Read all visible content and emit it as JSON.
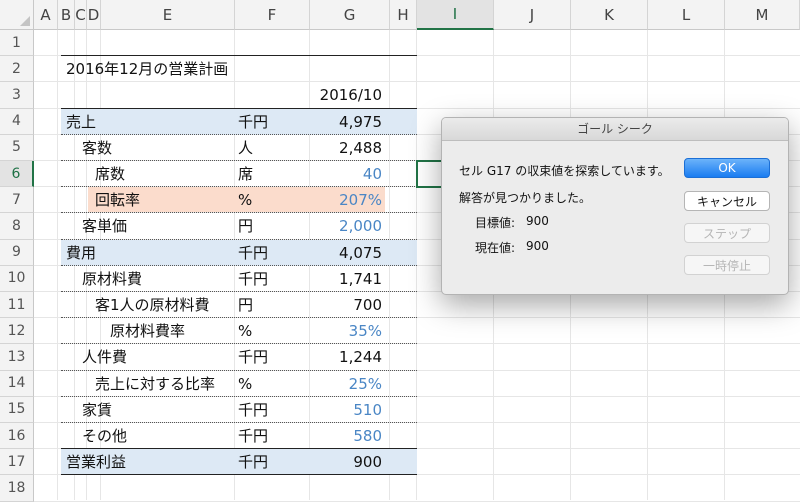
{
  "columns": [
    "A",
    "B",
    "C",
    "D",
    "E",
    "F",
    "G",
    "H",
    "I",
    "J",
    "K",
    "L",
    "M"
  ],
  "selected_column": "I",
  "rows": [
    "1",
    "2",
    "3",
    "4",
    "5",
    "6",
    "7",
    "8",
    "9",
    "10",
    "11",
    "12",
    "13",
    "14",
    "15",
    "16",
    "17",
    "18"
  ],
  "selected_row": "6",
  "sheet": {
    "title": "2016年12月の営業計画",
    "period": "2016/10",
    "lines": [
      {
        "row": 4,
        "label": "売上",
        "unit": "千円",
        "value": "4,975",
        "input": false
      },
      {
        "row": 5,
        "label": "客数",
        "unit": "人",
        "value": "2,488",
        "input": false
      },
      {
        "row": 6,
        "label": "席数",
        "unit": "席",
        "value": "40",
        "input": true
      },
      {
        "row": 7,
        "label": "回転率",
        "unit": "%",
        "value": "207%",
        "input": true
      },
      {
        "row": 8,
        "label": "客単価",
        "unit": "円",
        "value": "2,000",
        "input": true
      },
      {
        "row": 9,
        "label": "費用",
        "unit": "千円",
        "value": "4,075",
        "input": false
      },
      {
        "row": 10,
        "label": "原材料費",
        "unit": "千円",
        "value": "1,741",
        "input": false
      },
      {
        "row": 11,
        "label": "客1人の原材料費",
        "unit": "円",
        "value": "700",
        "input": false
      },
      {
        "row": 12,
        "label": "原材料費率",
        "unit": "%",
        "value": "35%",
        "input": true
      },
      {
        "row": 13,
        "label": "人件費",
        "unit": "千円",
        "value": "1,244",
        "input": false
      },
      {
        "row": 14,
        "label": "売上に対する比率",
        "unit": "%",
        "value": "25%",
        "input": true
      },
      {
        "row": 15,
        "label": "家賃",
        "unit": "千円",
        "value": "510",
        "input": true
      },
      {
        "row": 16,
        "label": "その他",
        "unit": "千円",
        "value": "580",
        "input": true
      },
      {
        "row": 17,
        "label": "営業利益",
        "unit": "千円",
        "value": "900",
        "input": false
      }
    ]
  },
  "dialog": {
    "title": "ゴール シーク",
    "message": "セル G17 の収束値を探索しています。",
    "status": "解答が見つかりました。",
    "target_label": "目標値:",
    "target_value": "900",
    "current_label": "現在値:",
    "current_value": "900",
    "ok_label": "OK",
    "cancel_label": "キャンセル",
    "step_label": "ステップ",
    "pause_label": "一時停止"
  },
  "colors": {
    "input_value": "#4a86c5",
    "band_blue": "#dde9f5",
    "band_salmon": "#fbdccc",
    "selection_green": "#217346"
  }
}
